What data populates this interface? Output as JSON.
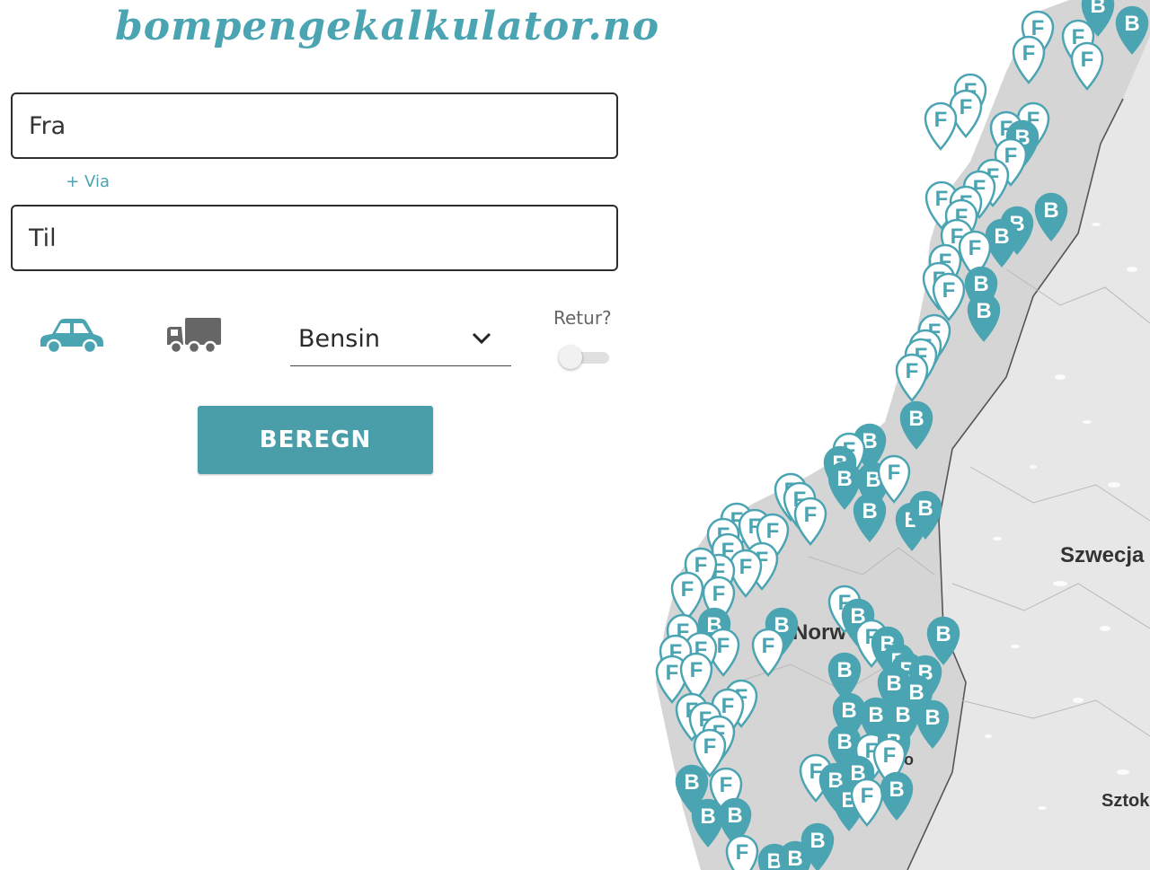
{
  "logo": {
    "text": "bompengekalkulator.no"
  },
  "form": {
    "from_placeholder": "Fra",
    "via_link": "+ Via",
    "to_placeholder": "Til",
    "vehicles": [
      {
        "icon": "car-icon",
        "selected": true
      },
      {
        "icon": "truck-icon",
        "selected": false
      }
    ],
    "fuel_selected": "Bensin",
    "return_label": "Retur?",
    "return_enabled": false,
    "submit_label": "BEREGN"
  },
  "map": {
    "labels": {
      "norway": "Norw",
      "sweden": "Szwecja",
      "stockholm": "Sztok",
      "oslo": "o"
    },
    "colors": {
      "land": "#dadada",
      "water": "#ffffff",
      "sweden": "#e8e8e8",
      "marker": "#4aa4b2",
      "marker_light": "#ffffff"
    },
    "marker_letters": {
      "toll": "B",
      "ferry": "F"
    }
  }
}
